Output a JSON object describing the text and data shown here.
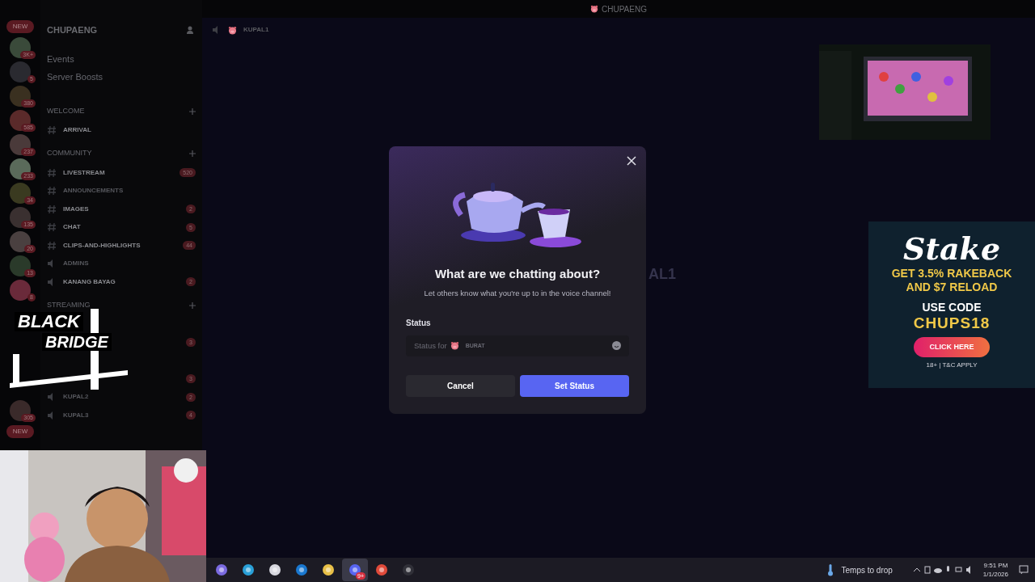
{
  "window": {
    "title": "CHUPAENG"
  },
  "server_rail": [
    {
      "badge": "NEW",
      "kind": "new"
    },
    {
      "badge": "3K+",
      "kind": "server",
      "color": "#3a4a3a"
    },
    {
      "badge": "5",
      "kind": "server",
      "color": "#2a2a30"
    },
    {
      "badge": "380",
      "kind": "server",
      "color": "#3a3020"
    },
    {
      "badge": "585",
      "kind": "server",
      "color": "#5a2a2a"
    },
    {
      "badge": "237",
      "kind": "server",
      "color": "#4a3a3a"
    },
    {
      "badge": "233",
      "kind": "server",
      "color": "#5a6a5a"
    },
    {
      "badge": "34",
      "kind": "server",
      "color": "#3a3a20"
    },
    {
      "badge": "135",
      "kind": "server",
      "color": "#3a3030"
    },
    {
      "badge": "20",
      "kind": "server",
      "color": "#4a4040"
    },
    {
      "badge": "13",
      "kind": "server",
      "color": "#2a3a2a"
    },
    {
      "badge": "8",
      "kind": "server",
      "color": "#6a2a3a"
    }
  ],
  "server_rail_bottom": [
    {
      "badge": "305",
      "kind": "server",
      "color": "#3a2a2a"
    },
    {
      "badge": "NEW",
      "kind": "new"
    }
  ],
  "sidebar": {
    "server_name": "CHUPAENG",
    "items": [
      {
        "kind": "link",
        "name": "Events"
      },
      {
        "kind": "link",
        "name": "Server Boosts"
      },
      {
        "kind": "category",
        "name": "WELCOME"
      },
      {
        "kind": "text",
        "name": "ARRIVAL",
        "unread": true
      },
      {
        "kind": "category",
        "name": "COMMUNITY"
      },
      {
        "kind": "text",
        "name": "LIVESTREAM",
        "unread": true,
        "badge": "520"
      },
      {
        "kind": "text",
        "name": "ANNOUNCEMENTS",
        "unread": false
      },
      {
        "kind": "text",
        "name": "IMAGES",
        "unread": true,
        "badge": "2"
      },
      {
        "kind": "text",
        "name": "CHAT",
        "unread": true,
        "badge": "5"
      },
      {
        "kind": "text",
        "name": "CLIPS-AND-HIGHLIGHTS",
        "unread": true,
        "badge": "44"
      },
      {
        "kind": "voice",
        "name": "ADMINS",
        "unread": false
      },
      {
        "kind": "voice",
        "name": "KANANG BAYAG",
        "unread": true,
        "badge": "2"
      },
      {
        "kind": "category",
        "name": "STREAMING"
      },
      {
        "kind": "hidden"
      },
      {
        "kind": "hidden",
        "badge": "3"
      },
      {
        "kind": "hidden"
      },
      {
        "kind": "hidden",
        "badge": "3"
      },
      {
        "kind": "voice",
        "name": "KUPAL2",
        "unread": false,
        "badge": "2"
      },
      {
        "kind": "voice",
        "name": "KUPAL3",
        "unread": false,
        "badge": "4"
      }
    ]
  },
  "header": {
    "channel": "KUPAL1"
  },
  "background_text": "AL1",
  "modal": {
    "title": "What are we chatting about?",
    "subtitle": "Let others know what you're up to in the voice channel!",
    "field_label": "Status",
    "placeholder": "Status for",
    "channel": "BURAT",
    "buttons": [
      {
        "label": "Cancel",
        "kind": "secondary"
      },
      {
        "label": "Set Status",
        "kind": "primary"
      }
    ]
  },
  "overlay_logo": [
    "BLACK",
    "BRIDGE"
  ],
  "ad": {
    "brand": "Stake",
    "offer": [
      "GET 3.5% RAKEBACK",
      "AND $7 RELOAD"
    ],
    "code_label": "USE CODE",
    "code": "CHUPS18",
    "cta": "CLICK HERE",
    "terms": "18+ | T&C APPLY"
  },
  "taskbar": {
    "apps": [
      {
        "kind": "copilot",
        "selected": false
      },
      {
        "kind": "edge",
        "selected": false
      },
      {
        "kind": "store",
        "selected": false
      },
      {
        "kind": "mail",
        "selected": false
      },
      {
        "kind": "folder",
        "selected": false
      },
      {
        "kind": "discord",
        "selected": true,
        "badge": "9+"
      },
      {
        "kind": "chrome",
        "selected": false
      },
      {
        "kind": "obs",
        "selected": false
      }
    ],
    "weather": "Temps to drop",
    "time": "9:51 PM",
    "date": "1/1/2026"
  }
}
